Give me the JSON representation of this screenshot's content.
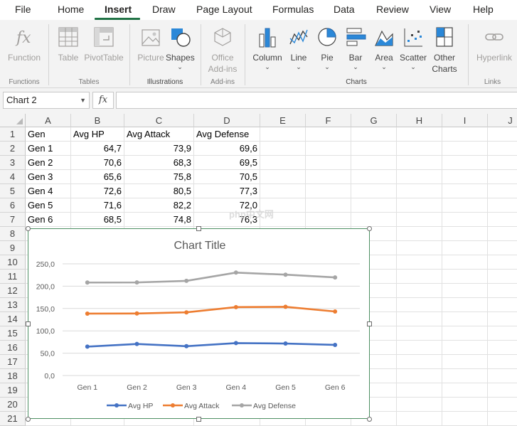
{
  "menu": {
    "items": [
      "File",
      "Home",
      "Insert",
      "Draw",
      "Page Layout",
      "Formulas",
      "Data",
      "Review",
      "View",
      "Help"
    ],
    "active": "Insert"
  },
  "ribbon": {
    "function_label": "Function",
    "table_label": "Table",
    "pivottable_label": "PivotTable",
    "picture_label": "Picture",
    "shapes_label": "Shapes",
    "office_addins_label_1": "Office",
    "office_addins_label_2": "Add-ins",
    "column_label": "Column",
    "line_label": "Line",
    "pie_label": "Pie",
    "bar_label": "Bar",
    "area_label": "Area",
    "scatter_label": "Scatter",
    "other_charts_label_1": "Other",
    "other_charts_label_2": "Charts",
    "hyperlink_label": "Hyperlink",
    "groups": {
      "functions": "Functions",
      "tables": "Tables",
      "illustrations": "Illustrations",
      "addins": "Add-ins",
      "charts": "Charts",
      "links": "Links"
    },
    "caret": "⌄"
  },
  "formula_bar": {
    "name_box": "Chart 2",
    "fx": "fx",
    "formula": ""
  },
  "sheet": {
    "columns": [
      "A",
      "B",
      "C",
      "D",
      "E",
      "F",
      "G",
      "H",
      "I",
      "J"
    ],
    "rows": [
      "1",
      "2",
      "3",
      "4",
      "5",
      "6",
      "7",
      "8",
      "9",
      "10",
      "11",
      "12",
      "13",
      "14",
      "15",
      "16",
      "17",
      "18",
      "19",
      "20",
      "21"
    ],
    "header_row": [
      "Gen",
      "Avg HP",
      "Avg Attack",
      "Avg Defense"
    ],
    "data_rows": [
      [
        "Gen 1",
        "64,7",
        "73,9",
        "69,6"
      ],
      [
        "Gen 2",
        "70,6",
        "68,3",
        "69,5"
      ],
      [
        "Gen 3",
        "65,6",
        "75,8",
        "70,5"
      ],
      [
        "Gen 4",
        "72,6",
        "80,5",
        "77,3"
      ],
      [
        "Gen 5",
        "71,6",
        "82,2",
        "72,0"
      ],
      [
        "Gen 6",
        "68,5",
        "74,8",
        "76,3"
      ]
    ]
  },
  "chart_data": {
    "type": "line",
    "stacked": true,
    "title": "Chart Title",
    "categories": [
      "Gen 1",
      "Gen 2",
      "Gen 3",
      "Gen 4",
      "Gen 5",
      "Gen 6"
    ],
    "series": [
      {
        "name": "Avg HP",
        "values": [
          64.7,
          70.6,
          65.6,
          72.6,
          71.6,
          68.5
        ],
        "color": "#4472c4"
      },
      {
        "name": "Avg Attack",
        "values": [
          73.9,
          68.3,
          75.8,
          80.5,
          82.2,
          74.8
        ],
        "color": "#ed7d31"
      },
      {
        "name": "Avg Defense",
        "values": [
          69.6,
          69.5,
          70.5,
          77.3,
          72.0,
          76.3
        ],
        "color": "#a5a5a5"
      }
    ],
    "ylim": [
      0,
      250
    ],
    "yticks": [
      "0,0",
      "50,0",
      "100,0",
      "150,0",
      "200,0",
      "250,0"
    ],
    "legend_position": "bottom",
    "grid": true
  },
  "watermark": "php中文网",
  "colors": {
    "accent": "#217346",
    "selection_border": "#4e8f63"
  }
}
